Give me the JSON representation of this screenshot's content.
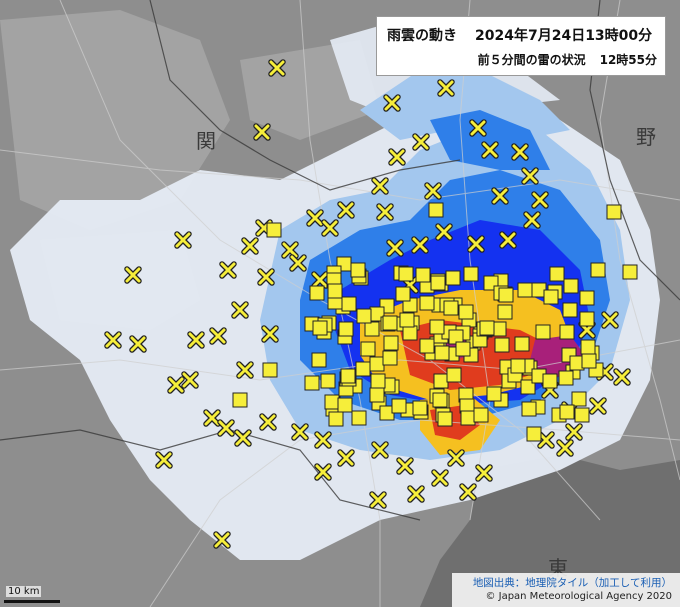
{
  "title": {
    "main_label": "雨雲の動き",
    "main_datetime": "2024年7月24日13時00分",
    "sub_label": "前５分間の雷の状況",
    "sub_time": "12時55分"
  },
  "map_labels": {
    "kanji_1": "関",
    "kanji_2": "野",
    "kanji_3": "東"
  },
  "credits": {
    "tiles": "地図出典：地理院タイル（加工して利用）",
    "copyright": "© Japan Meteorological Agency 2020"
  },
  "scale": {
    "label": "10 km"
  },
  "colors": {
    "land": "#8e8e8e",
    "urban": "#a7a7a7",
    "road": "#cfcfcf",
    "sea": "#707070",
    "rain_light": "#e6ecf6",
    "rain_weak": "#a3c7ee",
    "rain_moderate": "#2f7fe9",
    "rain_strong": "#1432f0",
    "rain_heavy": "#f5c020",
    "rain_very_heavy": "#e03c1e",
    "rain_extreme": "#a8207a",
    "lightning_marker": "#f6ee3a",
    "marker_outline": "#222222"
  }
}
